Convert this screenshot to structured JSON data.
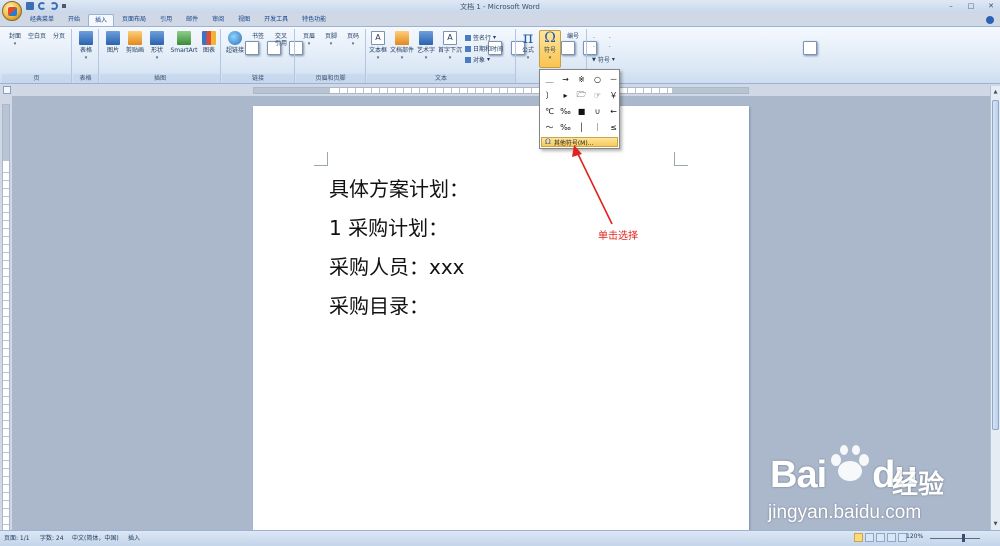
{
  "window": {
    "title": "文档 1 - Microsoft Word"
  },
  "tabs": [
    {
      "label": "经典菜单"
    },
    {
      "label": "开始"
    },
    {
      "label": "插入"
    },
    {
      "label": "页面布局"
    },
    {
      "label": "引用"
    },
    {
      "label": "邮件"
    },
    {
      "label": "审阅"
    },
    {
      "label": "视图"
    },
    {
      "label": "开发工具"
    },
    {
      "label": "特色功能"
    }
  ],
  "active_tab": "插入",
  "ribbon": {
    "groups": {
      "pages": "页",
      "tables": "表格",
      "illustrations": "插图",
      "links": "链接",
      "header_footer": "页眉和页脚",
      "text": "文本"
    },
    "buttons": {
      "cover": "封面",
      "blank_page": "空白页",
      "page_break": "分页",
      "table": "表格",
      "picture": "图片",
      "clipart": "剪贴画",
      "shapes": "形状",
      "smartart": "SmartArt",
      "chart": "图表",
      "hyperlink": "超链接",
      "bookmark": "书签",
      "cross_ref": "交叉引用",
      "header": "页眉",
      "footer": "页脚",
      "page_number": "页码",
      "textbox": "文本框",
      "quickparts": "文档部件",
      "wordart": "艺术字",
      "dropcap": "首字下沉",
      "signature": "签名行",
      "datetime": "日期和时间",
      "object": "对象",
      "equation": "公式",
      "symbol": "符号",
      "numbering": "编号",
      "symbol_right": "符号"
    },
    "mini_symbols": "· ·"
  },
  "symbol_panel": {
    "symbols": [
      "＿",
      "→",
      "※",
      "○",
      "－",
      "〕",
      "▸",
      "🗁",
      "☞",
      "￥",
      "℃",
      "‰",
      "■",
      "∪",
      "←",
      "～",
      "‰",
      "│",
      "｜",
      "≤"
    ],
    "more_label": "其他符号(M)..."
  },
  "annotation": {
    "text": "单击选择",
    "color": "#e0231c"
  },
  "document": {
    "lines": [
      "具体方案计划：",
      "1 采购计划：",
      "采购人员：xxx",
      "采购目录："
    ]
  },
  "statusbar": {
    "page": "页面: 1/1",
    "words": "字数: 24",
    "language": "中文(简体，中国)",
    "mode": "插入",
    "zoom": "120%"
  },
  "watermark": {
    "brand": "Bai",
    "brand2": "du",
    "cn": "经验",
    "url": "jingyan.baidu.com"
  }
}
